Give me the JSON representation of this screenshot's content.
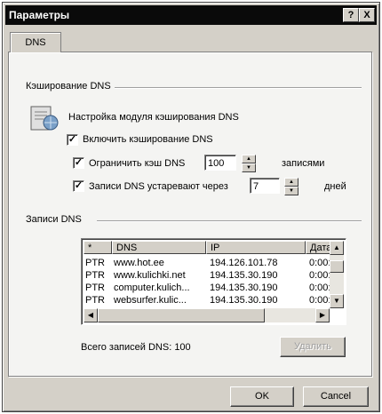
{
  "window": {
    "title": "Параметры",
    "help_btn": "?",
    "close_btn": "X"
  },
  "tabs": [
    {
      "label": "DNS"
    }
  ],
  "cache_group": {
    "title": "Кэширование DNS",
    "description": "Настройка модуля кэширования DNS",
    "enable_cache": {
      "label": "Включить кэширование DNS",
      "checked": true
    },
    "limit_cache": {
      "label": "Ограничить кэш DNS",
      "value": "100",
      "unit": "записями",
      "checked": true
    },
    "expire": {
      "label": "Записи DNS устаревают через",
      "value": "7",
      "unit": "дней",
      "checked": true
    }
  },
  "records_group": {
    "title": "Записи DNS",
    "columns": [
      "*",
      "DNS",
      "IP",
      "Дата"
    ],
    "rows": [
      [
        "PTR",
        "www.hot.ee",
        "194.126.101.78",
        "0:00:"
      ],
      [
        "PTR",
        "www.kulichki.net",
        "194.135.30.190",
        "0:00:"
      ],
      [
        "PTR",
        "computer.kulich...",
        "194.135.30.190",
        "0:00:"
      ],
      [
        "PTR",
        "websurfer.kulic...",
        "194.135.30.190",
        "0:00:"
      ]
    ],
    "total_label": "Всего записей DNS: 100",
    "delete_label": "Удалить"
  },
  "buttons": {
    "ok": "OK",
    "cancel": "Cancel"
  }
}
